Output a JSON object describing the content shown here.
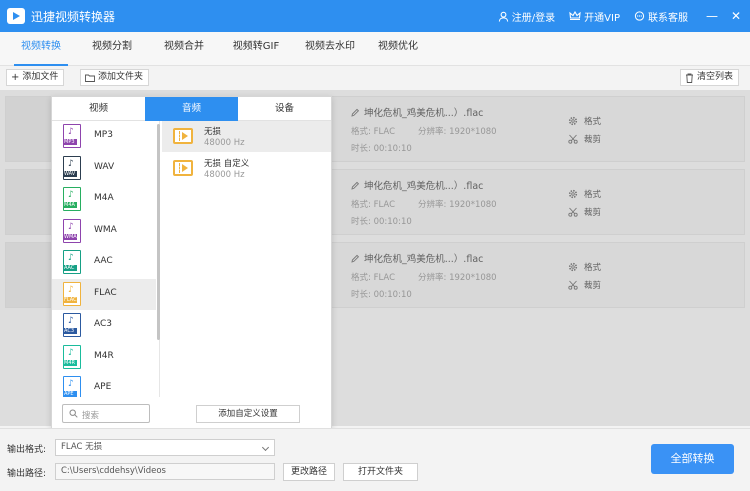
{
  "window": {
    "title": "迅捷视频转换器",
    "login": "注册/登录",
    "vip": "开通VIP",
    "support": "联系客服",
    "minimize": "—",
    "close": "✕"
  },
  "nav": {
    "tabs": [
      "视频转换",
      "视频分割",
      "视频合并",
      "视频转GIF",
      "视频去水印",
      "视频优化"
    ]
  },
  "toolbar": {
    "add_file": "添加文件",
    "add_folder": "添加文件夹",
    "clear_list": "清空列表"
  },
  "files": [
    {
      "name": "坤化危机_鸡美危机...）.flac",
      "format_label": "格式:",
      "format": "FLAC",
      "res_label": "分辨率:",
      "resolution": "1920*1080",
      "dur_label": "时长:",
      "duration": "00:10:10",
      "action_format": "格式",
      "action_cut": "裁剪"
    },
    {
      "name": "坤化危机_鸡美危机...）.flac",
      "format_label": "格式:",
      "format": "FLAC",
      "res_label": "分辨率:",
      "resolution": "1920*1080",
      "dur_label": "时长:",
      "duration": "00:10:10",
      "action_format": "格式",
      "action_cut": "裁剪"
    },
    {
      "name": "坤化危机_鸡美危机...）.flac",
      "format_label": "格式:",
      "format": "FLAC",
      "res_label": "分辨率:",
      "resolution": "1920*1080",
      "dur_label": "时长:",
      "duration": "00:10:10",
      "action_format": "格式",
      "action_cut": "裁剪"
    }
  ],
  "popup": {
    "tabs": [
      "视频",
      "音频",
      "设备"
    ],
    "active_tab": "音频",
    "formats": [
      {
        "name": "MP3",
        "color": "#8e44ad"
      },
      {
        "name": "WAV",
        "color": "#2c3e50"
      },
      {
        "name": "M4A",
        "color": "#27ae60"
      },
      {
        "name": "WMA",
        "color": "#8e44ad"
      },
      {
        "name": "AAC",
        "color": "#16a085"
      },
      {
        "name": "FLAC",
        "color": "#f0b33e"
      },
      {
        "name": "AC3",
        "color": "#2c5aa0"
      },
      {
        "name": "M4R",
        "color": "#1abc9c"
      },
      {
        "name": "APE",
        "color": "#2e8ff0"
      }
    ],
    "selected_format": "FLAC",
    "presets": [
      {
        "name": "无损",
        "sub": "48000 Hz"
      },
      {
        "name": "无损 自定义",
        "sub": "48000 Hz"
      }
    ],
    "search_placeholder": "搜索",
    "custom_button": "添加自定义设置"
  },
  "bottom": {
    "format_label": "输出格式:",
    "format_value": "FLAC  无损",
    "path_label": "输出路径:",
    "path_value": "C:\\Users\\cddehsy\\Videos",
    "change_path": "更改路径",
    "open_folder": "打开文件夹",
    "convert_all": "全部转换"
  },
  "colors": {
    "accent": "#2e8ff0",
    "preset_icon": "#f0b33e"
  }
}
